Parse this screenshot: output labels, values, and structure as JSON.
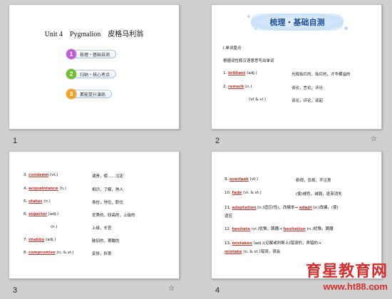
{
  "slides": {
    "s1": {
      "number": "1",
      "title": "Unit 4　Pygmalion　皮格马利翁",
      "menu": [
        {
          "num": "1",
          "label": "梳理・基础自测",
          "color": "#c25ad8"
        },
        {
          "num": "2",
          "label": "归纳・核心考点",
          "color": "#6fbf2a"
        },
        {
          "num": "3",
          "label": "素能提升演练",
          "color": "#f2a11f"
        }
      ]
    },
    "s2": {
      "number": "2",
      "anim_icon": "☆",
      "header": "梳理・基础自测",
      "section": "Ⅰ.单词盘点",
      "subsection": "根据词性和汉语意思写出单词",
      "items": [
        {
          "num": "1.",
          "word": "brilliant",
          "pos": "(adj.)",
          "meaning": "光辉灿烂的，灿烂的，才华横溢的"
        },
        {
          "num": "2.",
          "word": "remark",
          "pos": "(n.)",
          "meaning": "谈论，言论，评论"
        },
        {
          "num": "",
          "word": "",
          "pos": "(vt & vi.)",
          "meaning": "谈论，评论，谈起"
        }
      ]
    },
    "s3": {
      "number": "3",
      "anim_icon": "☆",
      "items": [
        {
          "num": "3.",
          "word": "condemn",
          "pos": "(vt.)",
          "meaning": "谴责，使……注定"
        },
        {
          "num": "4.",
          "word": "acquaintance",
          "pos": "(n.)",
          "meaning": "相识，了解，熟人"
        },
        {
          "num": "5.",
          "word": "status",
          "pos": "(n.)",
          "meaning": "身份，地位，职位"
        },
        {
          "num": "6.",
          "word": "superior",
          "pos": "(adj.)",
          "meaning": "优秀的，较高的，上级的"
        },
        {
          "num": "",
          "word": "",
          "pos": "(n.)",
          "meaning": "上级，长官"
        },
        {
          "num": "7.",
          "word": "shabby",
          "pos": "(adj.)",
          "meaning": "破旧的，寒酸的"
        },
        {
          "num": "8.",
          "word": "compromise",
          "pos": "(n. & vi.)",
          "meaning": "妥协，折衷"
        }
      ]
    },
    "s4": {
      "number": "4",
      "anim_icon": "☆",
      "items": [
        {
          "num": "9.",
          "word": "overlook",
          "pos": "(vt.)",
          "meaning": "俯视，忽视，不注意"
        },
        {
          "num": "10.",
          "word": "fade",
          "pos": "(vi. & vt.)",
          "meaning": "(使)褪色，减弱，逐渐消失"
        },
        {
          "num": "11.",
          "word": "adaptation",
          "pos": "(n.)适应(性)，改编本→",
          "word2": "adapt",
          "pos2": "(v.)改编，(使)",
          "meaning": "适应"
        },
        {
          "num": "12.",
          "word": "hesitate",
          "pos": "(vi.)犹豫，踌躇→",
          "word2": "hesitation",
          "pos2": "(n.)犹豫，踌躇",
          "meaning": ""
        },
        {
          "num": "13.",
          "word": "mistaken",
          "pos": "(adj.)(见解或判断上)错误的，弄错的→",
          "word2": "mistake",
          "pos2": "(n. & vt.)错误，误会",
          "meaning": ""
        }
      ]
    }
  },
  "watermark": {
    "title": "育星教育网",
    "url": "www.ht88.com"
  }
}
